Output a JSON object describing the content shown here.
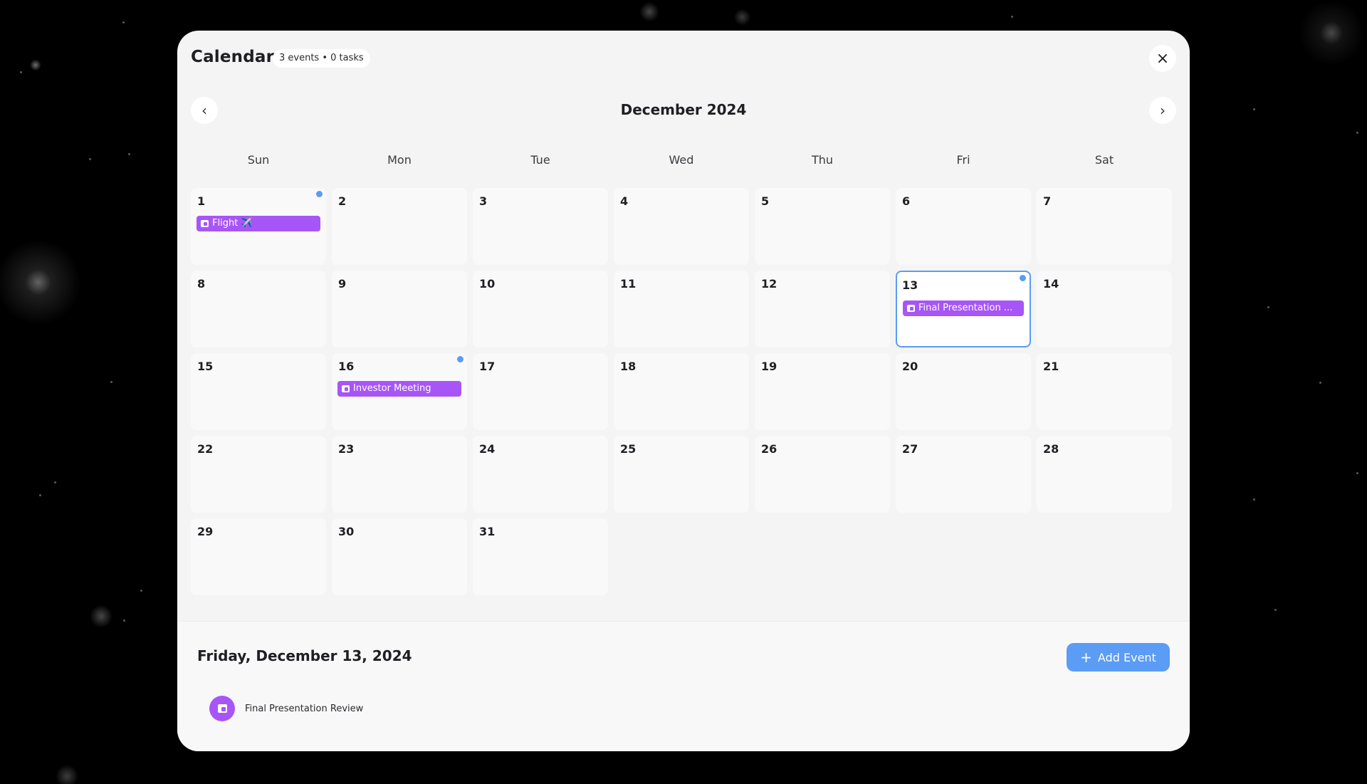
{
  "header": {
    "title": "Calendar",
    "badge": "3 events • 0 tasks",
    "close_icon": "×"
  },
  "nav": {
    "prev_icon": "‹",
    "next_icon": "›",
    "month_title": "December 2024"
  },
  "weekdays": [
    "Sun",
    "Mon",
    "Tue",
    "Wed",
    "Thu",
    "Fri",
    "Sat"
  ],
  "days": [
    {
      "num": "1"
    },
    {
      "num": "2"
    },
    {
      "num": "3"
    },
    {
      "num": "4"
    },
    {
      "num": "5"
    },
    {
      "num": "6"
    },
    {
      "num": "7"
    },
    {
      "num": "8"
    },
    {
      "num": "9"
    },
    {
      "num": "10"
    },
    {
      "num": "11"
    },
    {
      "num": "12"
    },
    {
      "num": "13"
    },
    {
      "num": "14"
    },
    {
      "num": "15"
    },
    {
      "num": "16"
    },
    {
      "num": "17"
    },
    {
      "num": "18"
    },
    {
      "num": "19"
    },
    {
      "num": "20"
    },
    {
      "num": "21"
    },
    {
      "num": "22"
    },
    {
      "num": "23"
    },
    {
      "num": "24"
    },
    {
      "num": "25"
    },
    {
      "num": "26"
    },
    {
      "num": "27"
    },
    {
      "num": "28"
    },
    {
      "num": "29"
    },
    {
      "num": "30"
    },
    {
      "num": "31"
    }
  ],
  "events": {
    "flight": "Flight ✈️",
    "final_presentation": "Final Presentation ...",
    "investor_meeting": "Investor Meeting"
  },
  "selected": {
    "date_label": "Friday, December 13, 2024",
    "add_button": "Add Event",
    "add_icon": "+",
    "event_label": "Final Presentation Review"
  },
  "colors": {
    "accent_blue": "#5b9cf5",
    "event_purple": "#a855f7"
  }
}
